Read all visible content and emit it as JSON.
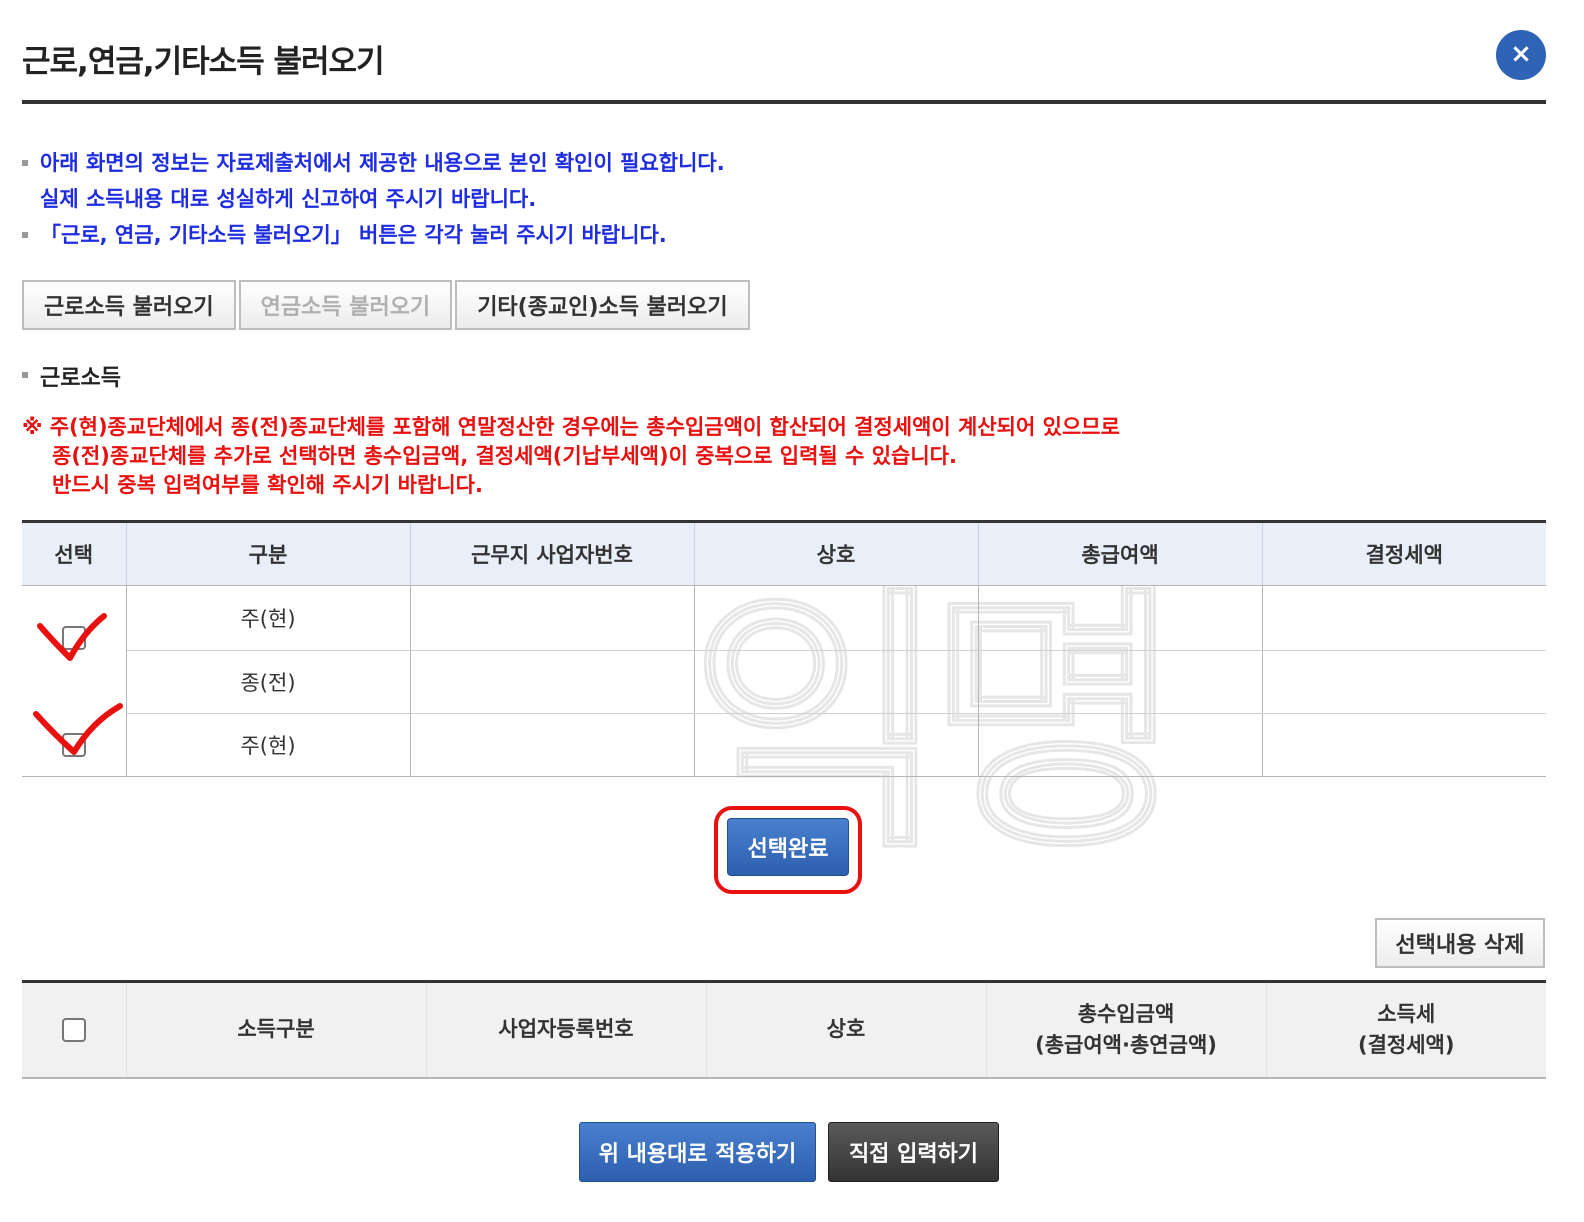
{
  "dialog": {
    "title": "근로,연금,기타소득 불러오기",
    "close_label": "×"
  },
  "notice": {
    "lines": [
      "아래 화면의 정보는 자료제출처에서 제공한 내용으로 본인 확인이 필요합니다.",
      "실제 소득내용 대로 성실하게 신고하여 주시기 바랍니다.",
      "「근로, 연금, 기타소득 불러오기」 버튼은 각각 눌러 주시기 바랍니다."
    ]
  },
  "tabs": [
    {
      "label": "근로소득 불러오기",
      "enabled": true
    },
    {
      "label": "연금소득 불러오기",
      "enabled": false
    },
    {
      "label": "기타(종교인)소득 불러오기",
      "enabled": true
    }
  ],
  "section": {
    "label": "근로소득"
  },
  "warning": {
    "lines": [
      "※ 주(현)종교단체에서 종(전)종교단체를 포함해 연말정산한 경우에는 총수입금액이 합산되어 결정세액이 계산되어 있으므로",
      "종(전)종교단체를 추가로 선택하면 총수입금액, 결정세액(기납부세액)이 중복으로 입력될 수 있습니다.",
      "반드시 중복 입력여부를 확인해 주시기 바랍니다."
    ]
  },
  "income_table": {
    "headers": [
      "선택",
      "구분",
      "근무지 사업자번호",
      "상호",
      "총급여액",
      "결정세액"
    ],
    "rows": [
      {
        "type": "주(현)",
        "biz_no": "",
        "name": "",
        "total_pay": "",
        "tax": "",
        "checked": true
      },
      {
        "type": "종(전)",
        "biz_no": "",
        "name": "",
        "total_pay": "",
        "tax": "",
        "checked": false
      },
      {
        "type": "주(현)",
        "biz_no": "",
        "name": "",
        "total_pay": "",
        "tax": "",
        "checked": true
      }
    ]
  },
  "watermark": {
    "text": "익명"
  },
  "confirm_button": {
    "label": "선택완료"
  },
  "delete_button": {
    "label": "선택내용 삭제"
  },
  "selected_table": {
    "headers": [
      "",
      "소득구분",
      "사업자등록번호",
      "상호",
      "총수입금액\n(총급여액·총연금액)",
      "소득세\n(결정세액)"
    ],
    "header_lines": {
      "total_income": [
        "총수입금액",
        "(총급여액·총연금액)"
      ],
      "income_tax": [
        "소득세",
        "(결정세액)"
      ]
    }
  },
  "footer": {
    "apply_label": "위 내용대로 적용하기",
    "manual_label": "직접 입력하기"
  },
  "colors": {
    "primary": "#2f63b5",
    "notice_text": "#1f2de0",
    "warning_text": "#e8110f",
    "annotation": "#e8110f",
    "header_bg": "#e9eff8"
  }
}
